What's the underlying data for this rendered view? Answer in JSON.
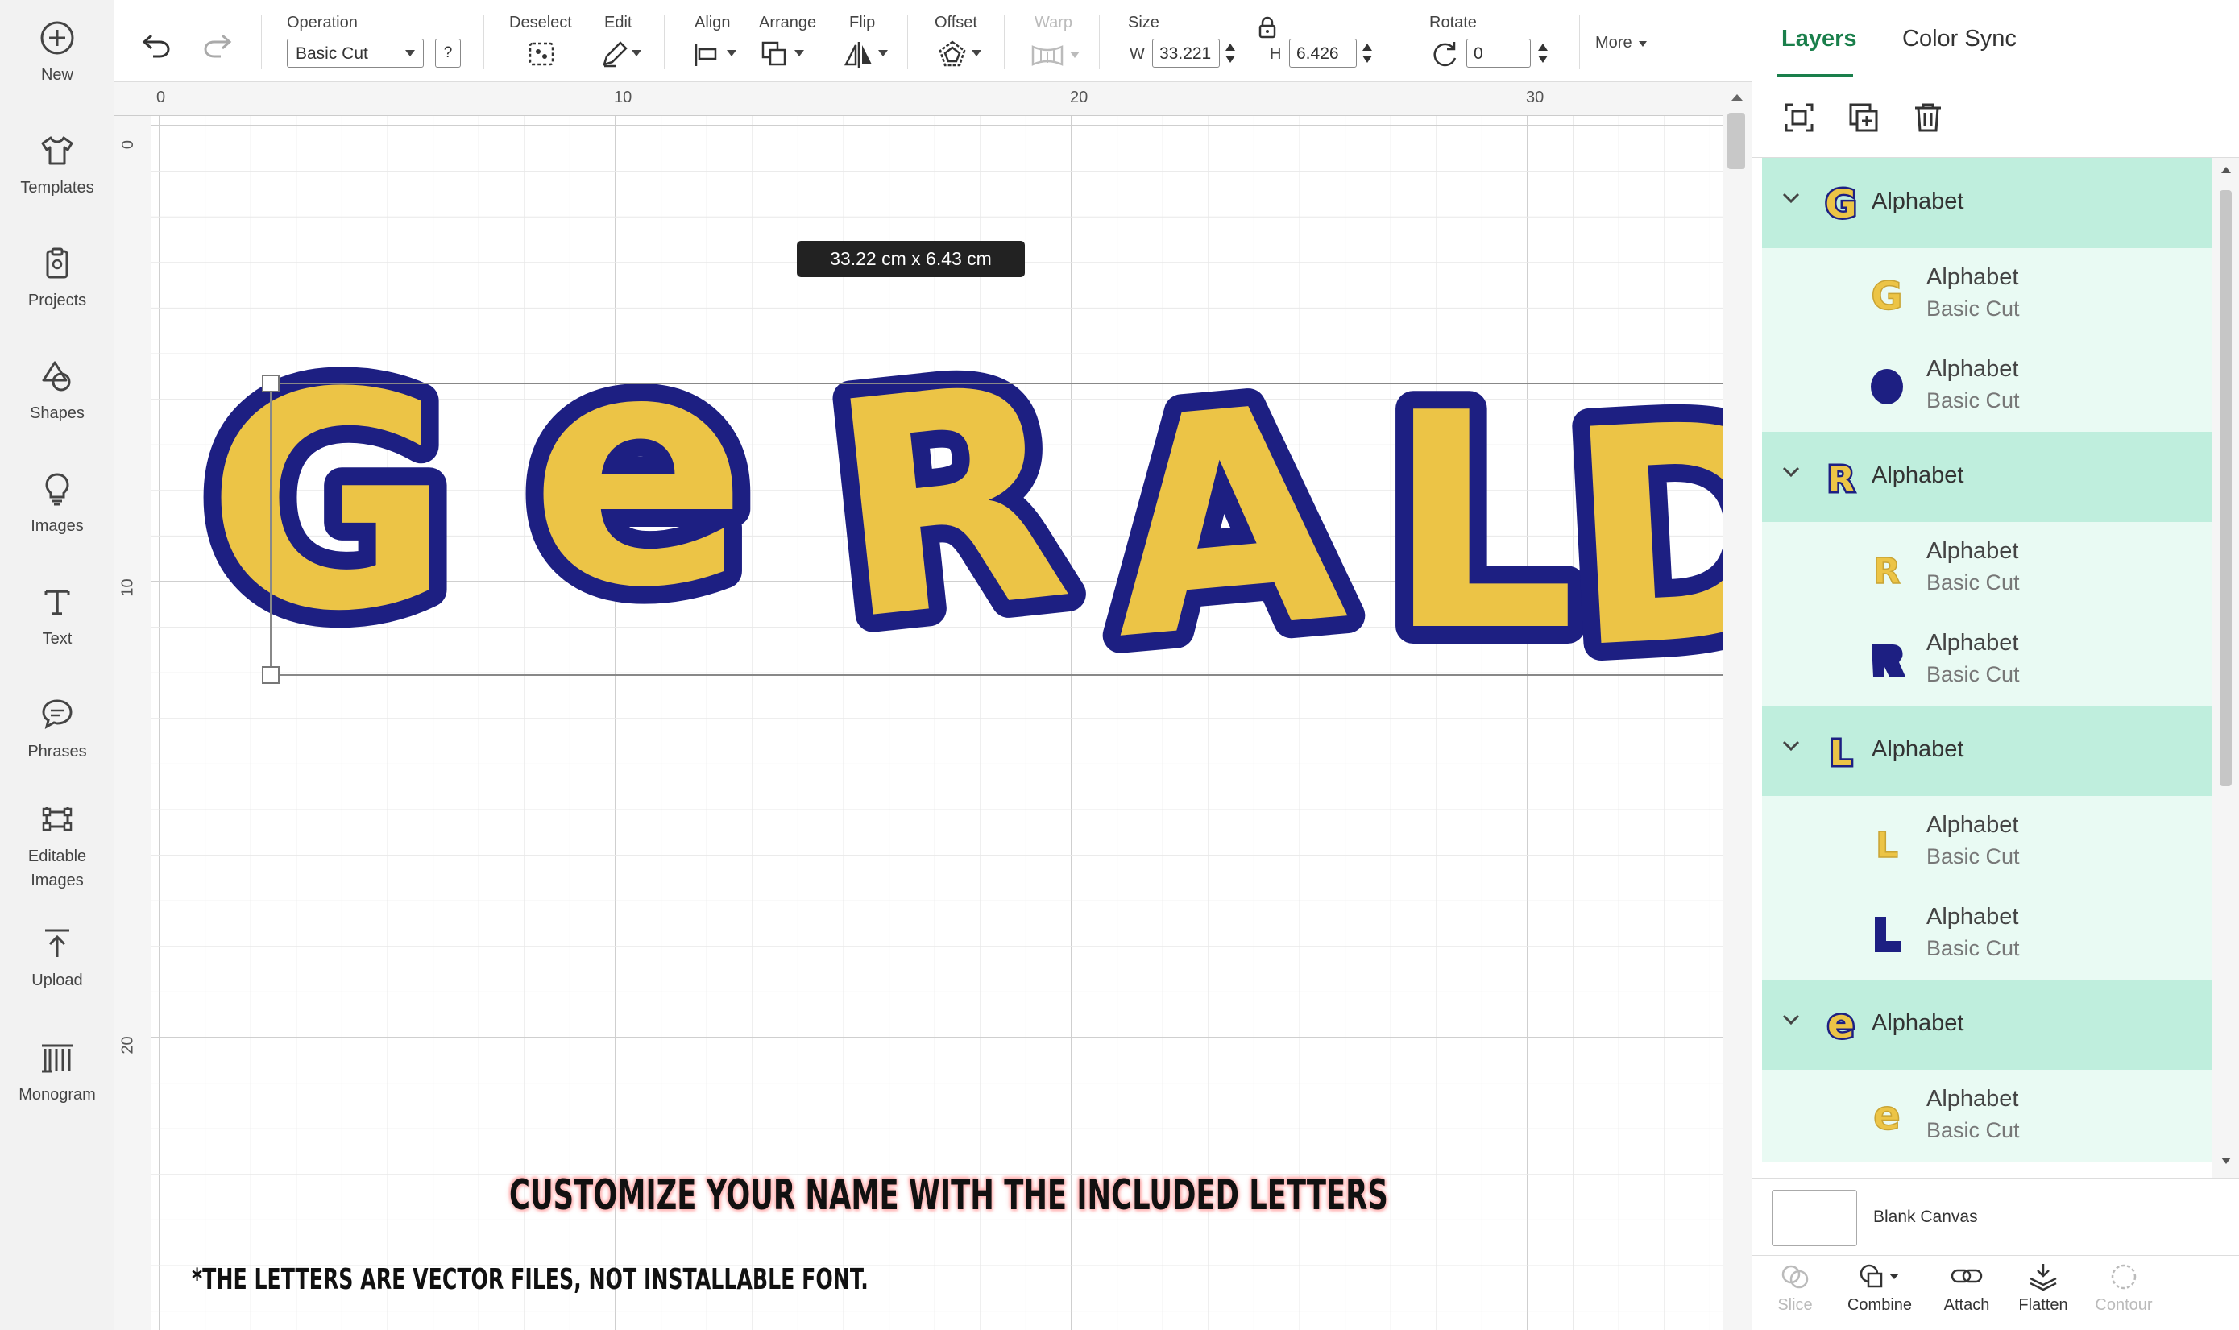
{
  "sidebar": {
    "items": [
      {
        "label": "New",
        "icon": "plus-circle-icon"
      },
      {
        "label": "Templates",
        "icon": "tshirt-icon"
      },
      {
        "label": "Projects",
        "icon": "clipboard-icon"
      },
      {
        "label": "Shapes",
        "icon": "shapes-icon"
      },
      {
        "label": "Images",
        "icon": "lightbulb-icon"
      },
      {
        "label": "Text",
        "icon": "text-icon"
      },
      {
        "label": "Phrases",
        "icon": "speech-bubble-icon"
      },
      {
        "label": "Editable\nImages",
        "icon": "editable-images-icon"
      },
      {
        "label": "Upload",
        "icon": "upload-icon"
      },
      {
        "label": "Monogram",
        "icon": "monogram-icon"
      }
    ]
  },
  "toolbar": {
    "operation_label": "Operation",
    "operation_value": "Basic Cut",
    "help": "?",
    "deselect_label": "Deselect",
    "edit_label": "Edit",
    "align_label": "Align",
    "arrange_label": "Arrange",
    "flip_label": "Flip",
    "offset_label": "Offset",
    "warp_label": "Warp",
    "size_label": "Size",
    "w_label": "W",
    "w_value": "33.221",
    "h_label": "H",
    "h_value": "6.426",
    "rotate_label": "Rotate",
    "rotate_value": "0",
    "more_label": "More"
  },
  "canvas": {
    "ruler_top": [
      "0",
      "10",
      "20",
      "30"
    ],
    "ruler_left": [
      "0",
      "10",
      "20"
    ],
    "size_tooltip": "33.22  cm x 6.43  cm",
    "design_text": "GERALD",
    "promo_main": "CUSTOMIZE YOUR NAME WITH THE INCLUDED LETTERS",
    "promo_sub": "*THE LETTERS ARE VECTOR FILES, NOT INSTALLABLE FONT."
  },
  "colors": {
    "navy": "#1d1f82",
    "yellow": "#ecc446",
    "accent": "#1a7f4b",
    "layer_group_bg": "#bfeedd",
    "layer_child_bg": "#e9faf3"
  },
  "panel": {
    "tabs": [
      "Layers",
      "Color Sync"
    ],
    "groups": [
      {
        "letter": "G",
        "name": "Alphabet",
        "children": [
          {
            "name": "Alphabet",
            "op": "Basic Cut",
            "fill": "yellow"
          },
          {
            "name": "Alphabet",
            "op": "Basic Cut",
            "fill": "navy"
          }
        ]
      },
      {
        "letter": "R",
        "name": "Alphabet",
        "children": [
          {
            "name": "Alphabet",
            "op": "Basic Cut",
            "fill": "yellow"
          },
          {
            "name": "Alphabet",
            "op": "Basic Cut",
            "fill": "navy"
          }
        ]
      },
      {
        "letter": "L",
        "name": "Alphabet",
        "children": [
          {
            "name": "Alphabet",
            "op": "Basic Cut",
            "fill": "yellow"
          },
          {
            "name": "Alphabet",
            "op": "Basic Cut",
            "fill": "navy"
          }
        ]
      },
      {
        "letter": "e",
        "name": "Alphabet",
        "children": [
          {
            "name": "Alphabet",
            "op": "Basic Cut",
            "fill": "yellow"
          }
        ]
      }
    ],
    "blank_canvas": "Blank Canvas",
    "actions": [
      "Slice",
      "Combine",
      "Attach",
      "Flatten",
      "Contour"
    ]
  }
}
